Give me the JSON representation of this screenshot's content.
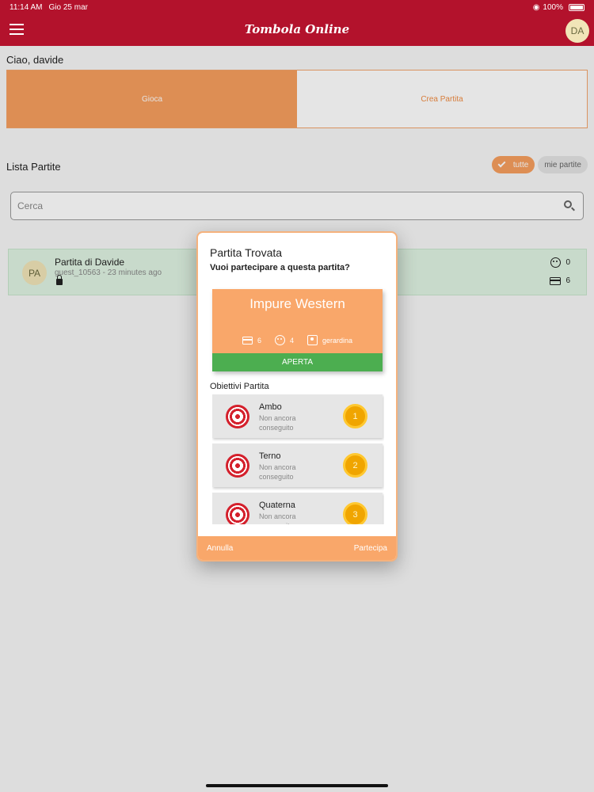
{
  "status_bar": {
    "time": "11:14 AM",
    "date": "Gio 25 mar",
    "battery": "100%"
  },
  "app_bar": {
    "title": "Tombola Online",
    "avatar": "DA"
  },
  "home": {
    "greeting": "Ciao, davide",
    "tabs": [
      {
        "label": "Gioca",
        "active": true
      },
      {
        "label": "Crea Partita",
        "active": false
      }
    ],
    "list_title": "Lista Partite",
    "filters": [
      {
        "label": "tutte",
        "selected": true
      },
      {
        "label": "mie partite",
        "selected": false
      }
    ],
    "search": {
      "placeholder": "Cerca",
      "value": ""
    },
    "games": [
      {
        "avatar": "PA",
        "name": "Partita di Davide",
        "subtitle": "guest_10563 - 23 minutes ago",
        "locked": true,
        "players": "0",
        "cards": "6"
      }
    ]
  },
  "dialog": {
    "title": "Partita Trovata",
    "question": "Vuoi partecipare a questa partita?",
    "game": {
      "name": "Impure Western",
      "cards": "6",
      "players": "4",
      "owner": "gerardina",
      "status": "APERTA"
    },
    "objectives_title": "Obiettivi Partita",
    "objectives": [
      {
        "name": "Ambo",
        "status": "Non ancora conseguito",
        "number": "1"
      },
      {
        "name": "Terno",
        "status": "Non ancora conseguito",
        "number": "2"
      },
      {
        "name": "Quaterna",
        "status": "Non ancora conseguito",
        "number": "3"
      }
    ],
    "cancel_label": "Annulla",
    "join_label": "Partecipa"
  },
  "colors": {
    "primary": "#b3122c",
    "accent": "#f79f5e",
    "open_status": "#4cae50",
    "target": "#d4202c",
    "objective_badge": "#f0a500"
  },
  "icons": {
    "menu": "hamburger-icon",
    "search": "search-icon",
    "lock": "lock-icon",
    "players": "face-icon",
    "cards": "card-icon",
    "owner": "badge-icon",
    "objective": "target-icon"
  }
}
